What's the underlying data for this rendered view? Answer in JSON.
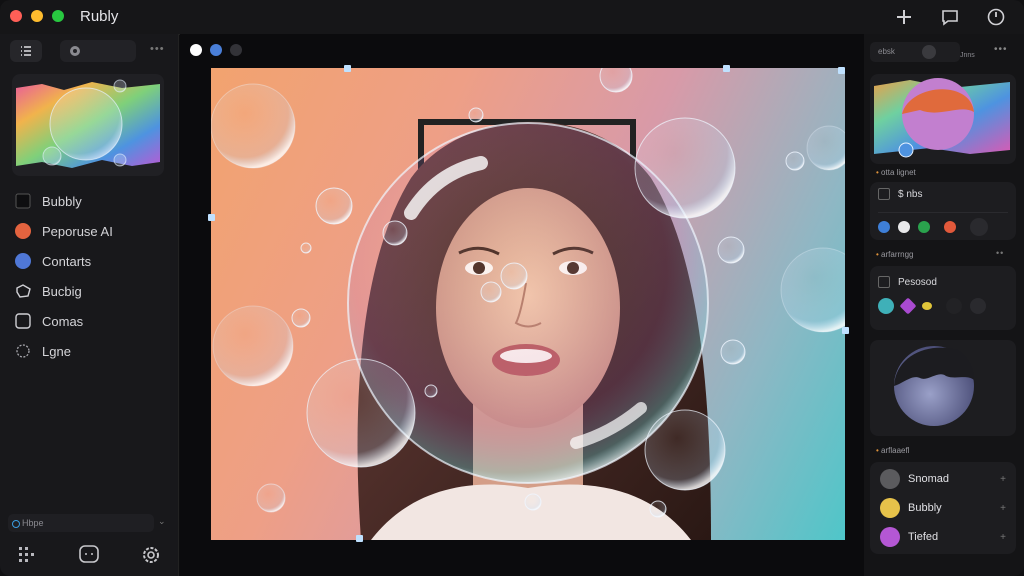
{
  "app": {
    "title": "Rubly"
  },
  "sidebar": {
    "items": [
      {
        "label": "Bubbly",
        "icon": "square-icon"
      },
      {
        "label": "Peporuse AI",
        "icon": "orange-circle-icon"
      },
      {
        "label": "Contarts",
        "icon": "blue-circle-icon"
      },
      {
        "label": "Bucbig",
        "icon": "tag-icon"
      },
      {
        "label": "Comas",
        "icon": "frame-icon"
      },
      {
        "label": "Lgne",
        "icon": "sun-icon"
      }
    ],
    "search_placeholder": "Hbpe"
  },
  "right_panel": {
    "tab_label": "ebsk",
    "tab_label2": "Jnns",
    "section1_label": "otta lignet",
    "section1_row": "$ nbs",
    "section2_label": "arfarrngg",
    "section2_row": "Pesosod",
    "section3_label": "arflaaefl",
    "layers": [
      {
        "label": "Snomad",
        "color": "#5b5b5e"
      },
      {
        "label": "Bubbly",
        "color": "#e6c24a"
      },
      {
        "label": "Tiefed",
        "color": "#b457d4"
      }
    ],
    "colors1": [
      "#3e7fd8",
      "#e8e8ea",
      "#2aa24d",
      "#e2593b",
      "#2a2a2e"
    ],
    "colors2": [
      "#3fb0b8",
      "#a94ad0",
      "#e0c53a",
      "#222225",
      "#2a2a2e"
    ]
  },
  "canvas": {
    "window_dots": [
      "#ffffff",
      "#4a7fd8",
      "#333338"
    ]
  }
}
